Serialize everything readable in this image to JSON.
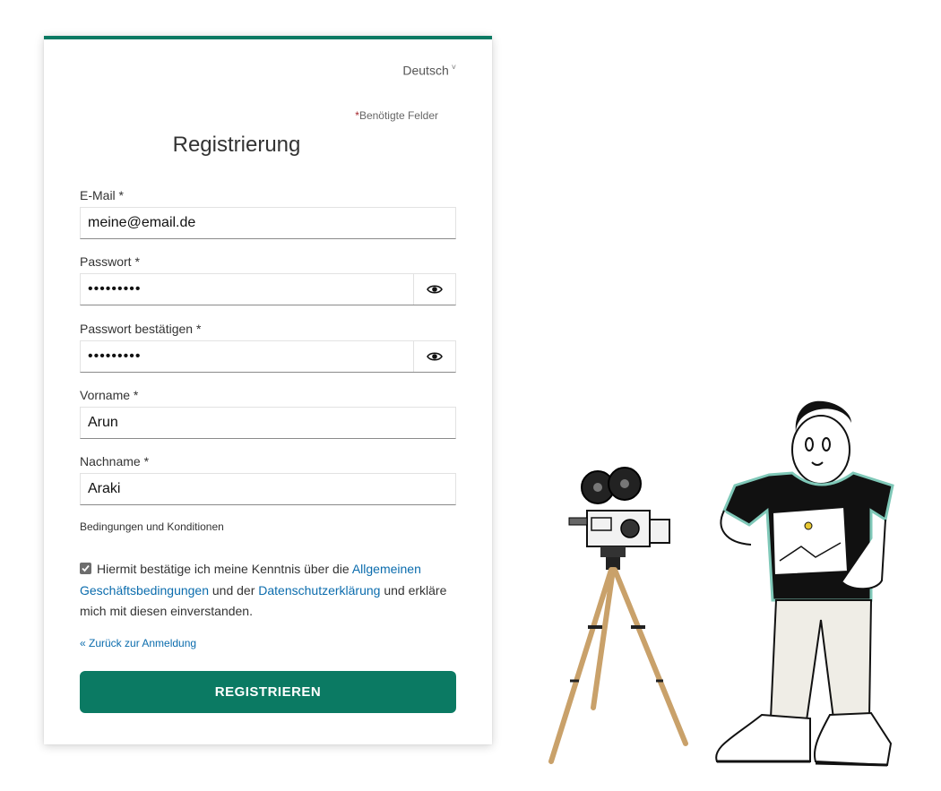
{
  "language": {
    "label": "Deutsch",
    "caret": "˅"
  },
  "required_note": {
    "star": "*",
    "text": "Benötigte Felder"
  },
  "title": "Registrierung",
  "fields": {
    "email": {
      "label": "E-Mail *",
      "value": "meine@email.de"
    },
    "password": {
      "label": "Passwort *",
      "value": "•••••••••"
    },
    "password_confirm": {
      "label": "Passwort bestätigen *",
      "value": "•••••••••"
    },
    "first_name": {
      "label": "Vorname *",
      "value": "Arun"
    },
    "last_name": {
      "label": "Nachname *",
      "value": "Araki"
    }
  },
  "terms": {
    "heading": "Bedingungen und Konditionen",
    "checked": true,
    "text_before": "Hiermit bestätige ich meine Kenntnis über die ",
    "link_agb": "Allgemeinen Geschäftsbedingungen",
    "text_middle": " und der ",
    "link_privacy": "Datenschutzerklärung",
    "text_after": " und erkläre mich mit diesen einverstanden."
  },
  "back_link": "« Zurück zur Anmeldung",
  "submit_label": "REGISTRIEREN",
  "colors": {
    "accent": "#0b7a63",
    "link": "#0b6cad",
    "required": "#a4262c"
  },
  "icons": {
    "password_toggle": "eye-icon",
    "consent": "checkbox-checked-icon"
  }
}
